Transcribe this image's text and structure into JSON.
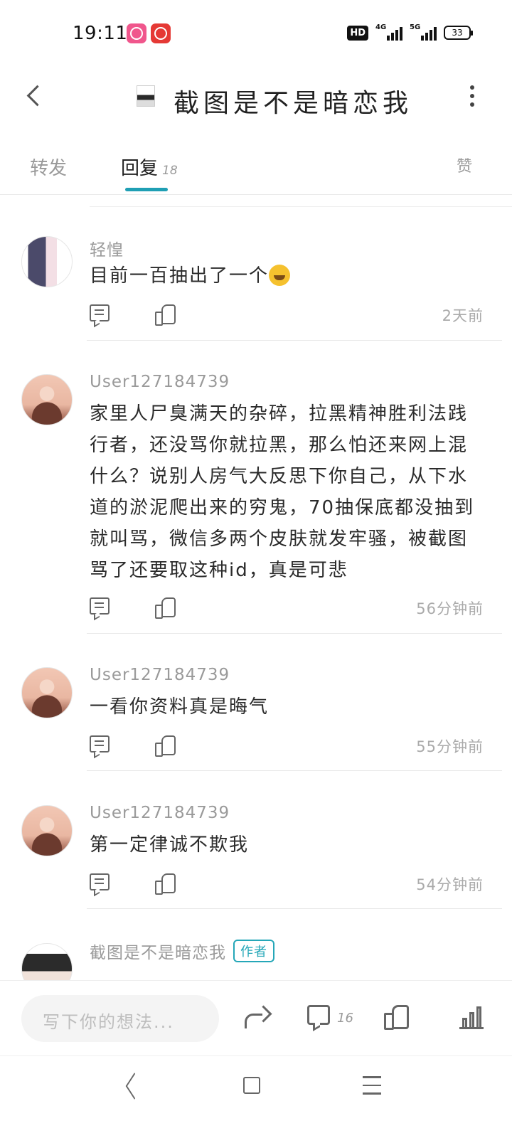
{
  "status_bar": {
    "time": "19:11",
    "hd_label": "HD",
    "network_1": "4G",
    "network_2": "5G",
    "battery": "33"
  },
  "header": {
    "title": "截图是不是暗恋我"
  },
  "tabs": [
    {
      "label": "转发"
    },
    {
      "label": "回复",
      "count": "18"
    },
    {
      "label": "赞"
    }
  ],
  "comments": [
    {
      "username": "轻惶",
      "text": "目前一百抽出了一个",
      "emoji": "sweat-smile",
      "time": "2天前"
    },
    {
      "username": "User127184739",
      "text": "家里人尸臭满天的杂碎，拉黑精神胜利法践行者，还没骂你就拉黑，那么怕还来网上混什么？说别人房气大反思下你自己，从下水道的淤泥爬出来的穷鬼，70抽保底都没抽到就叫骂，微信多两个皮肤就发牢骚，被截图骂了还要取这种id，真是可悲",
      "time": "56分钟前"
    },
    {
      "username": "User127184739",
      "text": "一看你资料真是晦气",
      "time": "55分钟前"
    },
    {
      "username": "User127184739",
      "text": "第一定律诚不欺我",
      "time": "54分钟前"
    },
    {
      "username": "截图是不是暗恋我",
      "badge": "作者",
      "text": ""
    }
  ],
  "bottom_bar": {
    "compose_placeholder": "写下你的想法...",
    "comment_count": "16"
  },
  "colors": {
    "accent": "#1f9fb4",
    "author_badge": "#25a7b8"
  }
}
